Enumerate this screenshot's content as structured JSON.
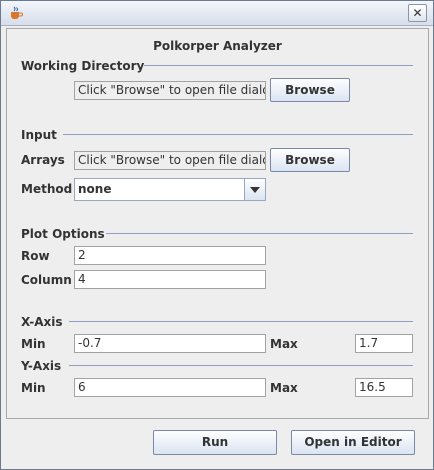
{
  "window": {
    "close_symbol": "✕"
  },
  "panel": {
    "title": "Polkorper Analyzer",
    "working_directory": {
      "section_label": "Working Directory",
      "path_placeholder": "Click \"Browse\" to open file dialog",
      "browse_label": "Browse"
    },
    "input": {
      "section_label": "Input",
      "arrays_label": "Arrays",
      "arrays_placeholder": "Click \"Browse\" to open file dialog",
      "browse_label": "Browse",
      "method_label": "Method",
      "method_selected": "none"
    },
    "plot_options": {
      "section_label": "Plot Options",
      "row_label": "Row",
      "row_value": "2",
      "column_label": "Column",
      "column_value": "4"
    },
    "x_axis": {
      "section_label": "X-Axis",
      "min_label": "Min",
      "min_value": "-0.7",
      "max_label": "Max",
      "max_value": "1.7"
    },
    "y_axis": {
      "section_label": "Y-Axis",
      "min_label": "Min",
      "min_value": "6",
      "max_label": "Max",
      "max_value": "16.5"
    }
  },
  "buttons": {
    "run_label": "Run",
    "open_editor_label": "Open in Editor"
  },
  "icons": {
    "app": "java-coffee-cup-icon",
    "close": "close-icon",
    "dropdown": "chevron-down-icon"
  },
  "colors": {
    "rule": "#8ea1c4",
    "button_border": "#7a8aa6"
  }
}
